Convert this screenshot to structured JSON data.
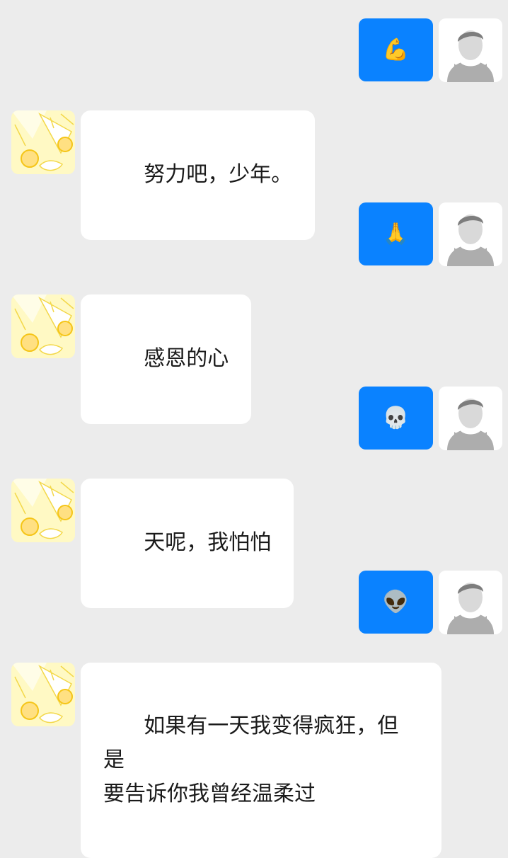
{
  "theme": {
    "background": "#ececec",
    "outgoing_bubble": "#0a82ff",
    "incoming_bubble": "#ffffff",
    "text": "#1a1a1a"
  },
  "messages": [
    {
      "direction": "outgoing",
      "content": "💪",
      "icon": "flexed-biceps-emoji",
      "avatar": "default-user-avatar"
    },
    {
      "direction": "incoming",
      "content": "努力吧，少年。",
      "avatar": "anime-character-avatar"
    },
    {
      "direction": "outgoing",
      "content": "🙏",
      "icon": "folded-hands-emoji",
      "avatar": "default-user-avatar"
    },
    {
      "direction": "incoming",
      "content": "感恩的心",
      "avatar": "anime-character-avatar"
    },
    {
      "direction": "outgoing",
      "content": "💀",
      "icon": "skull-emoji",
      "avatar": "default-user-avatar"
    },
    {
      "direction": "incoming",
      "content": "天呢，我怕怕",
      "avatar": "anime-character-avatar"
    },
    {
      "direction": "outgoing",
      "content": "👽",
      "icon": "alien-emoji",
      "avatar": "default-user-avatar"
    },
    {
      "direction": "incoming",
      "content": "如果有一天我变得疯狂，但是\n要告诉你我曾经温柔过",
      "avatar": "anime-character-avatar"
    }
  ]
}
